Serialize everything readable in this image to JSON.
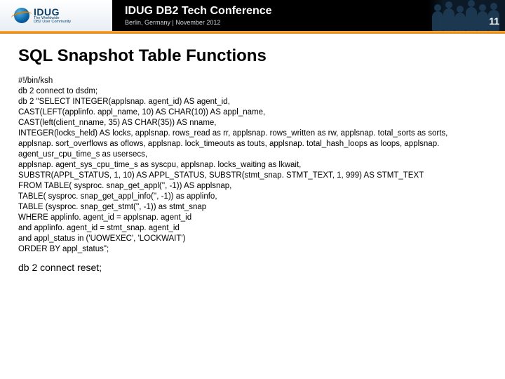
{
  "header": {
    "logo": {
      "name": "IDUG",
      "tagline": "The Worldwide\nDB2 User Community"
    },
    "conference_title": "IDUG DB2 Tech Conference",
    "conference_sub": "Berlin, Germany  |  November 2012",
    "page_number": "11"
  },
  "slide": {
    "title": "SQL Snapshot Table Functions",
    "code_lines": [
      "#!/bin/ksh",
      "db 2 connect to dsdm;",
      "db 2 \"SELECT INTEGER(applsnap. agent_id) AS agent_id,",
      "CAST(LEFT(applinfo. appl_name, 10) AS CHAR(10)) AS appl_name,",
      "CAST(left(client_nname, 35) AS CHAR(35)) AS nname,",
      " INTEGER(locks_held) AS locks, applsnap. rows_read as rr, applsnap. rows_written as rw, applsnap. total_sorts as sorts,",
      "applsnap. sort_overflows as oflows, applsnap. lock_timeouts as touts, applsnap. total_hash_loops as loops, applsnap. agent_usr_cpu_time_s as usersecs,",
      "applsnap. agent_sys_cpu_time_s as syscpu, applsnap. locks_waiting as lkwait,",
      " SUBSTR(APPL_STATUS, 1, 10) AS APPL_STATUS, SUBSTR(stmt_snap. STMT_TEXT, 1, 999) AS STMT_TEXT",
      "FROM TABLE( sysproc. snap_get_appl('', -1)) AS applsnap,",
      "TABLE( sysproc. snap_get_appl_info('', -1)) as applinfo,",
      "TABLE (sysproc. snap_get_stmt('', -1)) as stmt_snap",
      " WHERE applinfo. agent_id = applsnap. agent_id",
      "and applinfo. agent_id = stmt_snap. agent_id",
      "and appl_status in ('UOWEXEC', 'LOCKWAIT')",
      " ORDER BY appl_status\";"
    ],
    "footer_line": "db 2 connect reset;"
  }
}
